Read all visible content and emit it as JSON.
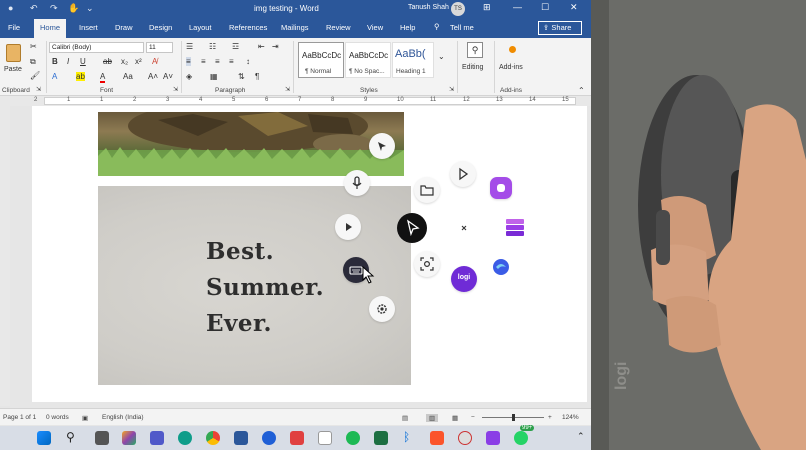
{
  "window": {
    "title": "img testing - Word",
    "user_name": "Tanush Shah",
    "user_initials": "TS"
  },
  "tabs": [
    "File",
    "Home",
    "Insert",
    "Draw",
    "Design",
    "Layout",
    "References",
    "Mailings",
    "Review",
    "View",
    "Help"
  ],
  "active_tab": "Home",
  "tell_me": "Tell me",
  "share_label": "Share",
  "ribbon": {
    "clipboard": {
      "label": "Clipboard",
      "paste": "Paste"
    },
    "font": {
      "label": "Font",
      "name": "Calibri (Body)",
      "size": "11"
    },
    "paragraph": {
      "label": "Paragraph"
    },
    "styles": {
      "label": "Styles",
      "items": [
        {
          "preview": "AaBbCcDc",
          "name": "¶ Normal"
        },
        {
          "preview": "AaBbCcDc",
          "name": "¶ No Spac..."
        },
        {
          "preview": "AaBb(",
          "name": "Heading 1"
        }
      ]
    },
    "editing": {
      "label": "Editing"
    },
    "addins": {
      "label": "Add-ins",
      "button": "Add-ins"
    }
  },
  "ruler_numbers": [
    "2",
    "1",
    "1",
    "2",
    "3",
    "4",
    "5",
    "6",
    "7",
    "8",
    "9",
    "10",
    "11",
    "12",
    "13",
    "14",
    "15"
  ],
  "document": {
    "image_text": [
      "Best.",
      "Summer.",
      "Ever."
    ]
  },
  "radial_menu": {
    "center_icon": "cursor-icon",
    "items": [
      {
        "name": "cursor-move-icon"
      },
      {
        "name": "microphone-icon"
      },
      {
        "name": "play-icon"
      },
      {
        "name": "keyboard-icon"
      },
      {
        "name": "settings-icon"
      },
      {
        "name": "folder-icon"
      },
      {
        "name": "play-icon"
      },
      {
        "name": "close-icon"
      },
      {
        "name": "screenshot-icon"
      },
      {
        "name": "logi-icon",
        "label": "logi"
      },
      {
        "name": "app-icon-purple"
      },
      {
        "name": "stack-icon"
      },
      {
        "name": "edge-icon"
      }
    ]
  },
  "status": {
    "page": "Page 1 of 1",
    "words": "0 words",
    "language": "English (India)",
    "zoom": "124%"
  },
  "taskbar": {
    "badge": "99+"
  },
  "webcam": {
    "brand_text": "logi"
  },
  "colors": {
    "word_blue": "#2b579a",
    "ribbon_bg": "#f3f3f3",
    "taskbar_bg": "#d8dde6"
  }
}
